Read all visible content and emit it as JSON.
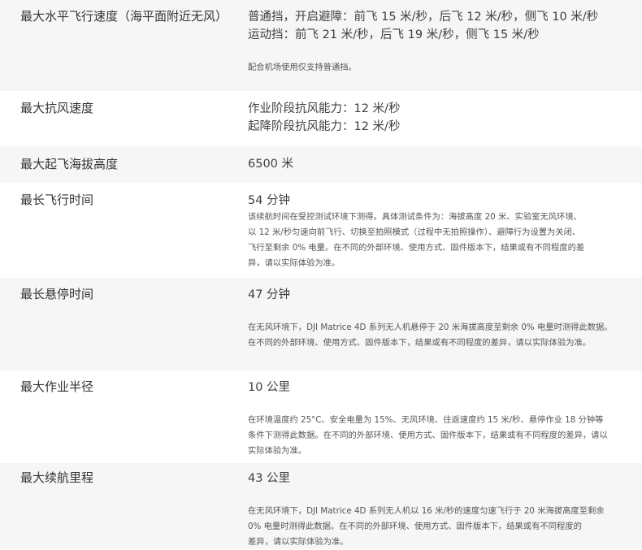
{
  "specs": [
    {
      "label": "最大水平飞行速度（海平面附近无风）",
      "values": [
        "普通挡，开启避障：前飞 15 米/秒，后飞 12 米/秒，侧飞 10 米/秒",
        "运动挡：前飞 21 米/秒，后飞 19 米/秒，侧飞 15 米/秒"
      ],
      "notes": [
        "配合机场使用仅支持普通挡。"
      ]
    },
    {
      "label": "最大抗风速度",
      "values": [
        "作业阶段抗风能力：12 米/秒",
        "起降阶段抗风能力：12 米/秒"
      ]
    },
    {
      "label": "最大起飞海拔高度",
      "values": [
        "6500 米"
      ]
    },
    {
      "label": "最长飞行时间",
      "values": [
        "54 分钟"
      ],
      "notes": [
        "该续航时间在受控测试环境下测得。具体测试条件为：海拔高度 20 米、实验室无风环境、",
        "以 12 米/秒匀速向前飞行、切换至拍照模式（过程中无拍照操作）、避障行为设置为关闭、",
        "飞行至剩余 0% 电量。在不同的外部环境、使用方式、固件版本下，结果或有不同程度的差",
        "异，请以实际体验为准。"
      ]
    },
    {
      "label": "最长悬停时间",
      "values": [
        "47 分钟"
      ],
      "notes": [
        "在无风环境下，DJI Matrice 4D 系列无人机悬停于 20 米海拔高度至剩余 0% 电量时测得此数据。",
        "在不同的外部环境、使用方式、固件版本下，结果或有不同程度的差异，请以实际体验为准。"
      ]
    },
    {
      "label": "最大作业半径",
      "values": [
        "10 公里"
      ],
      "notes": [
        "在环境温度约 25°C、安全电量为 15%、无风环境、往返速度约 15 米/秒、悬停作业 18 分钟等",
        "条件下测得此数据。在不同的外部环境、使用方式、固件版本下，结果或有不同程度的差异，请以",
        "实际体验为准。"
      ]
    },
    {
      "label": "最大续航里程",
      "values": [
        "43 公里"
      ],
      "notes": [
        "在无风环境下，DJI Matrice 4D 系列无人机以 16 米/秒的速度匀速飞行于 20 米海拔高度至剩余",
        "0% 电量时测得此数据。在不同的外部环境、使用方式、固件版本下，结果或有不同程度的",
        "差异，请以实际体验为准。"
      ]
    }
  ]
}
